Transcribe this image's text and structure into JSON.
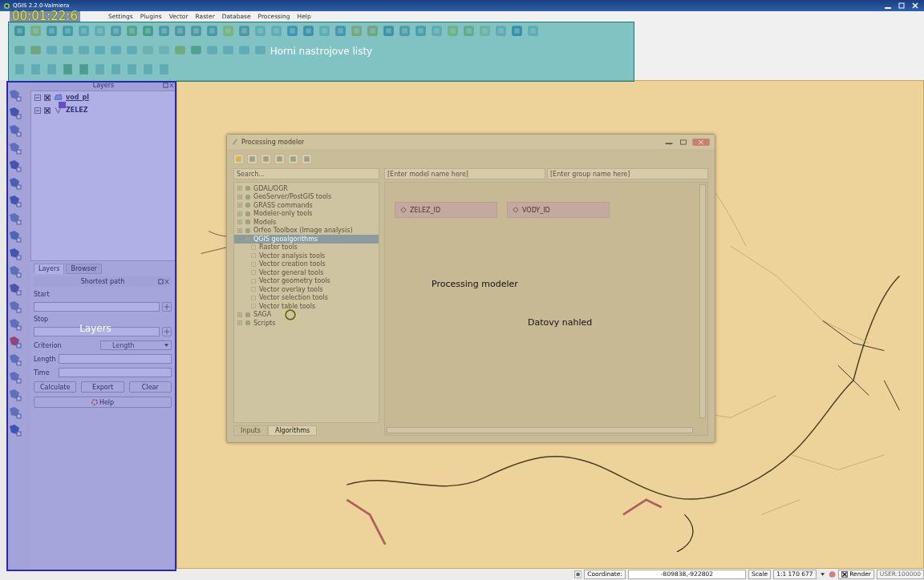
{
  "window": {
    "title": "QGIS 2.2.0-Valmiera"
  },
  "timer": "00:01:22:6",
  "menu": [
    "Settings",
    "Plugins",
    "Vector",
    "Raster",
    "Database",
    "Processing",
    "Help"
  ],
  "toolbar_overlay": {
    "label": "Horni nastrojove listy"
  },
  "layers_panel": {
    "title": "Layers",
    "layers": [
      {
        "name": "vod_pl",
        "checked": true,
        "kind": "polygon"
      },
      {
        "name": "ZELEZ",
        "checked": true,
        "kind": "line"
      }
    ],
    "tabs": [
      {
        "label": "Layers",
        "selected": true
      },
      {
        "label": "Browser",
        "selected": false
      }
    ]
  },
  "shortest_path": {
    "title": "Shortest path",
    "start_label": "Start",
    "stop_label": "Stop",
    "criterion_label": "Criterion",
    "criterion_value": "Length",
    "length_label": "Length",
    "time_label": "Time",
    "buttons": [
      "Calculate",
      "Export",
      "Clear"
    ],
    "help": "Help"
  },
  "layers_overlay": {
    "label": "Layers"
  },
  "modeler": {
    "title": "Processing modeler",
    "search": {
      "placeholder": "Search..."
    },
    "model_name": {
      "placeholder": "[Enter model name here]"
    },
    "group_name": {
      "placeholder": "[Enter group name here]"
    },
    "tree": [
      {
        "label": "GDAL/OGR",
        "expanded": false,
        "selected": false
      },
      {
        "label": "GeoServer/PostGIS tools",
        "expanded": false,
        "selected": false
      },
      {
        "label": "GRASS commands",
        "expanded": false,
        "selected": false
      },
      {
        "label": "Modeler-only tools",
        "expanded": false,
        "selected": false
      },
      {
        "label": "Models",
        "expanded": false,
        "selected": false
      },
      {
        "label": "Orfeo Toolbox (Image analysis)",
        "expanded": false,
        "selected": false
      },
      {
        "label": "QGIS geoalgorithms",
        "expanded": true,
        "selected": true,
        "children": [
          {
            "label": "Raster tools",
            "selected": false
          },
          {
            "label": "Vector analysis tools",
            "selected": false
          },
          {
            "label": "Vector creation tools",
            "selected": false
          },
          {
            "label": "Vector general tools",
            "selected": false
          },
          {
            "label": "Vector geometry tools",
            "selected": false
          },
          {
            "label": "Vector overlay tools",
            "selected": false
          },
          {
            "label": "Vector selection tools",
            "selected": false
          },
          {
            "label": "Vector table tools",
            "selected": false
          }
        ]
      },
      {
        "label": "SAGA",
        "expanded": false,
        "selected": false
      },
      {
        "label": "Scripts",
        "expanded": false,
        "selected": false
      }
    ],
    "tabs": [
      {
        "label": "Inputs",
        "selected": false
      },
      {
        "label": "Algorithms",
        "selected": true
      }
    ],
    "nodes": [
      {
        "label": "ZELEZ_ID"
      },
      {
        "label": "VODY_ID"
      }
    ]
  },
  "annotations": [
    {
      "text": "Processing modeler"
    },
    {
      "text": "Datovy nahled"
    }
  ],
  "status_bar": {
    "coordinate_label": "Coordinate:",
    "coordinate": "-809838,-922802",
    "scale_label": "Scale",
    "scale": "1:1 170 677",
    "render": {
      "label": "Render",
      "checked": true
    },
    "user": "USER:100000"
  }
}
